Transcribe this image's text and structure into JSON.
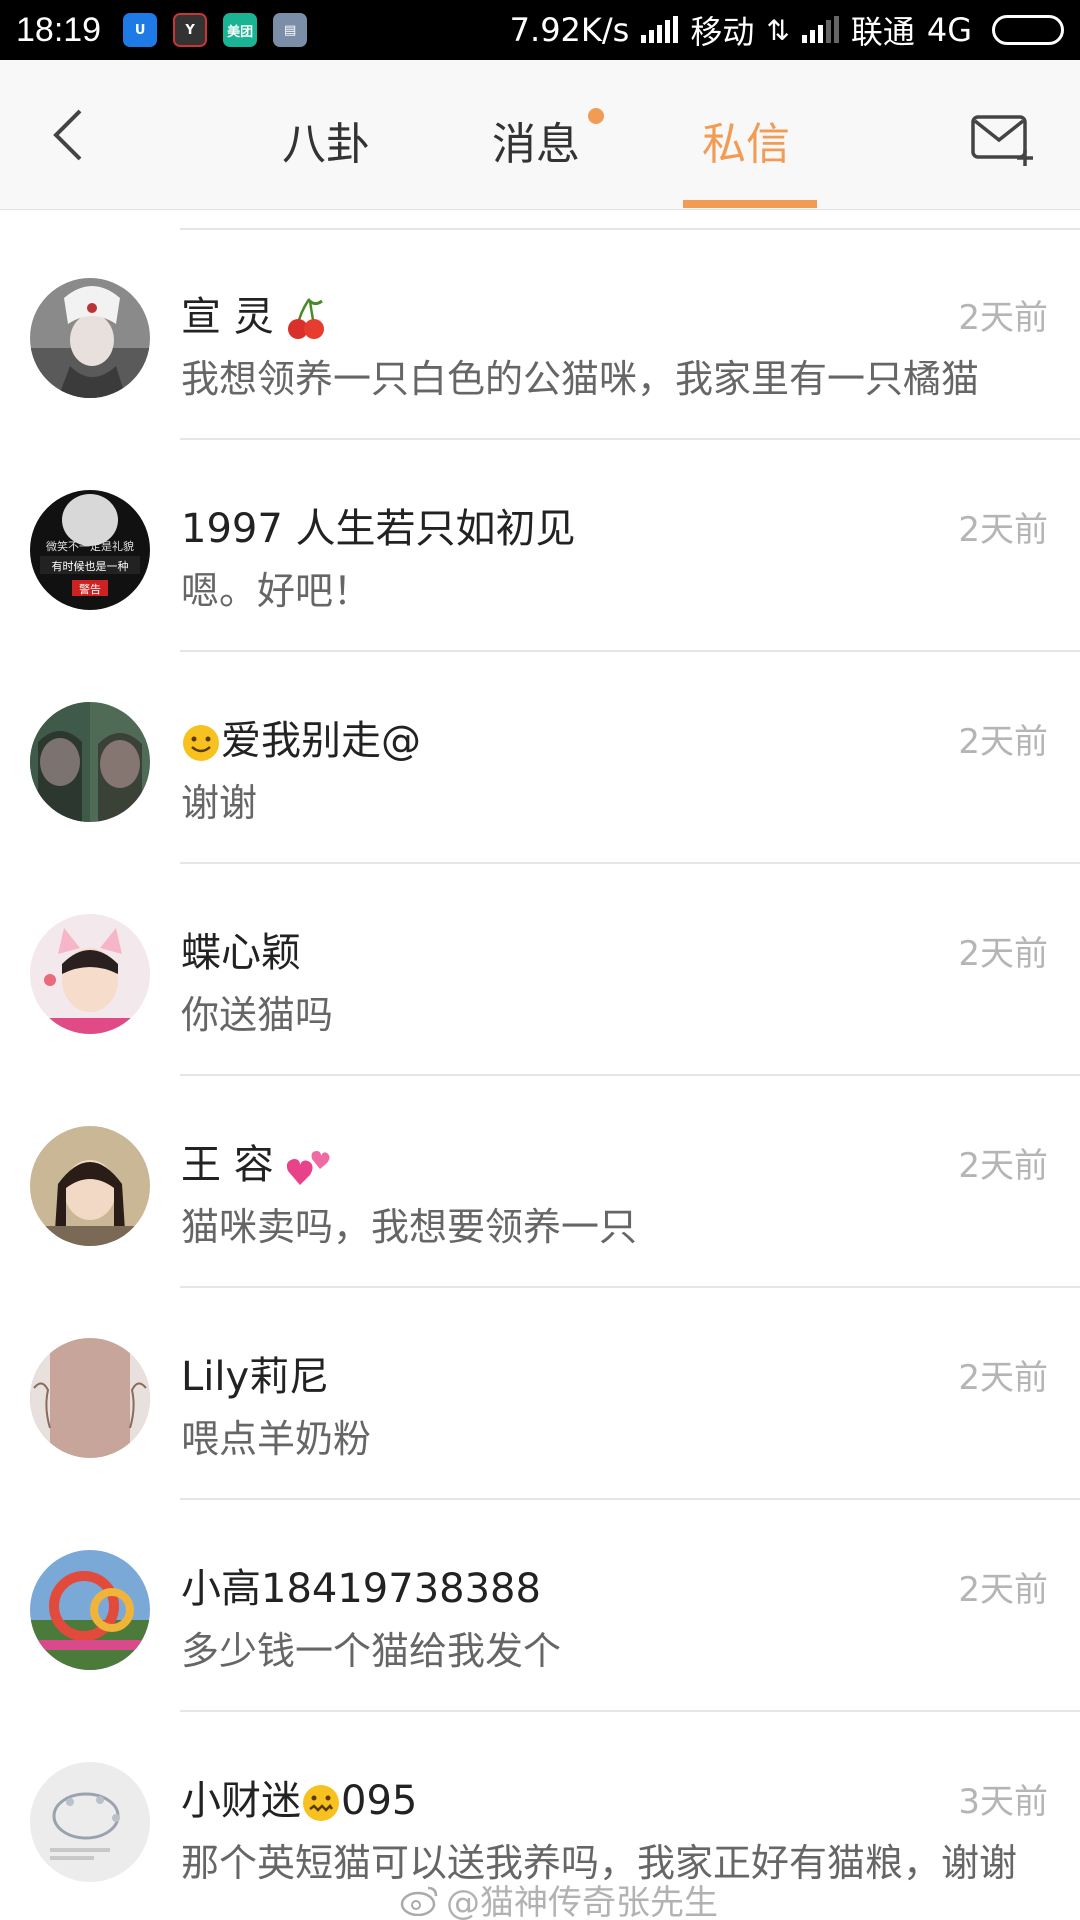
{
  "status_bar": {
    "time": "18:19",
    "speed": "7.92K/s",
    "carrier1": "移动",
    "carrier2": "联通",
    "network": "4G",
    "app_meituan": "美团"
  },
  "navbar": {
    "tabs": [
      {
        "label": "八卦"
      },
      {
        "label": "消息"
      },
      {
        "label": "私信"
      }
    ],
    "active_tab": "私信",
    "accent_color": "#f29b55"
  },
  "conversations": [
    {
      "name": "宣 灵",
      "name_emoji": "cherry",
      "time": "2天前",
      "message": "我想领养一只白色的公猫咪，我家里有一只橘猫"
    },
    {
      "name": "1997 人生若只如初见",
      "name_emoji": "",
      "time": "2天前",
      "message": "嗯。好吧！",
      "avatar_text": [
        "微笑不一定是礼貌",
        "有时候也是一种",
        "警告"
      ]
    },
    {
      "name": "爱我别走@",
      "name_emoji": "smile",
      "time": "2天前",
      "message": "谢谢"
    },
    {
      "name": "蝶心颖",
      "name_emoji": "",
      "time": "2天前",
      "message": "你送猫吗"
    },
    {
      "name": "王 容",
      "name_emoji": "hearts",
      "time": "2天前",
      "message": "猫咪卖吗，我想要领养一只"
    },
    {
      "name": "Lily莉尼",
      "name_emoji": "",
      "time": "2天前",
      "message": "喂点羊奶粉"
    },
    {
      "name": "小高18419738388",
      "name_emoji": "",
      "time": "2天前",
      "message": "多少钱一个猫给我发个"
    },
    {
      "name": "小财迷",
      "name_suffix": "095",
      "name_emoji": "zipper-face",
      "time": "3天前",
      "message": "那个英短猫可以送我养吗，我家正好有猫粮，谢谢"
    }
  ],
  "watermark": "@猫神传奇张先生"
}
